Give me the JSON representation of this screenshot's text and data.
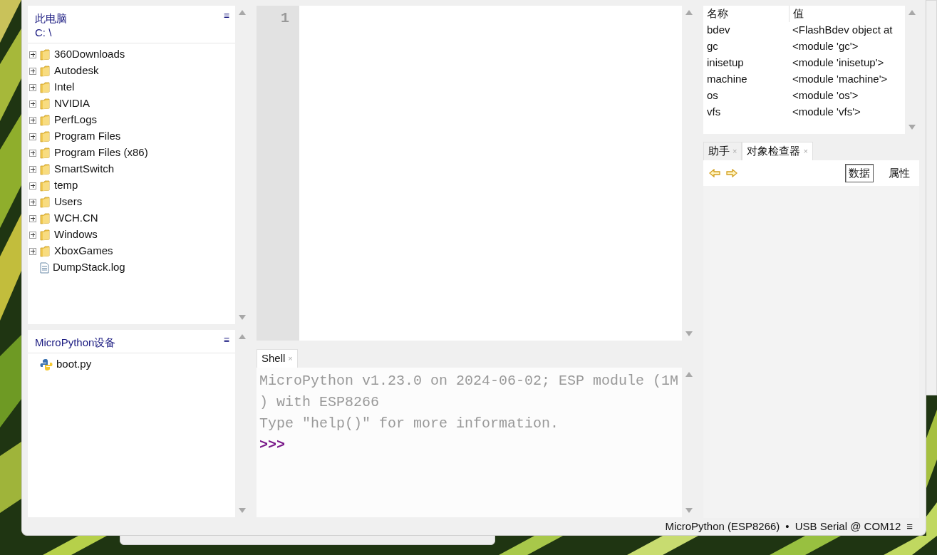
{
  "files": {
    "location": [
      "此电脑",
      "C: \\"
    ],
    "menu": "≡",
    "tree": [
      {
        "name": "360Downloads",
        "kind": "folder"
      },
      {
        "name": "Autodesk",
        "kind": "folder"
      },
      {
        "name": "Intel",
        "kind": "folder"
      },
      {
        "name": "NVIDIA",
        "kind": "folder"
      },
      {
        "name": "PerfLogs",
        "kind": "folder"
      },
      {
        "name": "Program Files",
        "kind": "folder"
      },
      {
        "name": "Program Files (x86)",
        "kind": "folder"
      },
      {
        "name": "SmartSwitch",
        "kind": "folder"
      },
      {
        "name": "temp",
        "kind": "folder"
      },
      {
        "name": "Users",
        "kind": "folder"
      },
      {
        "name": "WCH.CN",
        "kind": "folder"
      },
      {
        "name": "Windows",
        "kind": "folder"
      },
      {
        "name": "XboxGames",
        "kind": "folder"
      },
      {
        "name": "DumpStack.log",
        "kind": "file"
      }
    ]
  },
  "device": {
    "title": "MicroPython设备",
    "menu": "≡",
    "items": [
      {
        "name": "boot.py",
        "kind": "python"
      }
    ]
  },
  "editor": {
    "line_numbers": [
      "1"
    ]
  },
  "shell": {
    "tab": {
      "label": "Shell",
      "close": "×"
    },
    "lines": [
      {
        "text": "MicroPython v1.23.0 on 2024-06-02; ESP module (1M",
        "kind": "output"
      },
      {
        "text": ") with ESP8266",
        "kind": "output"
      },
      {
        "text": "Type \"help()\" for more information.",
        "kind": "output"
      },
      {
        "text": ">>>",
        "kind": "prompt"
      }
    ]
  },
  "variables": {
    "columns": [
      "名称",
      "值"
    ],
    "rows": [
      [
        "bdev",
        "<FlashBdev object at"
      ],
      [
        "gc",
        "<module 'gc'>"
      ],
      [
        "inisetup",
        "<module 'inisetup'>"
      ],
      [
        "machine",
        "<module 'machine'>"
      ],
      [
        "os",
        "<module 'os'>"
      ],
      [
        "vfs",
        "<module 'vfs'>"
      ]
    ]
  },
  "assist_tabs": [
    {
      "label": "助手",
      "close": "×",
      "selected": false
    },
    {
      "label": "对象检查器",
      "close": "×",
      "selected": true
    }
  ],
  "inspector": {
    "buttons": [
      {
        "label": "数据",
        "selected": true
      },
      {
        "label": "属性",
        "selected": false
      }
    ]
  },
  "status_bar": {
    "interpreter": "MicroPython (ESP8266)",
    "separator": "•",
    "port": "USB Serial @ COM12",
    "menu": "≡"
  }
}
